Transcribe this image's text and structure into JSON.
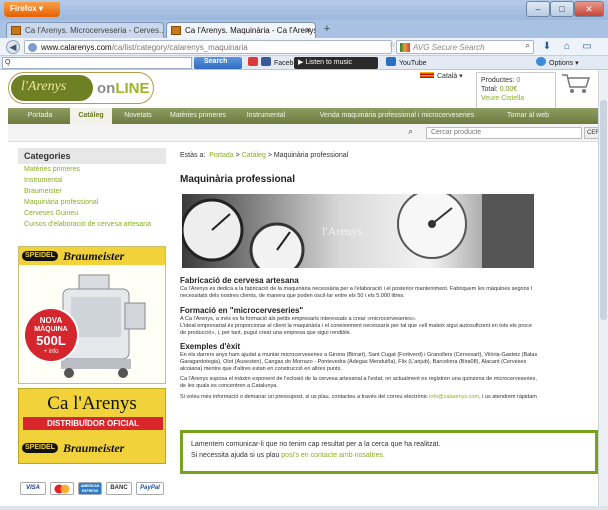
{
  "browser": {
    "firefox_label": "Firefox",
    "tabs": [
      {
        "label": "Ca l'Arenys. Microcerveseria - Cerves..."
      },
      {
        "label": "Ca l'Arenys. Maquinària - Ca l'Arenys"
      }
    ],
    "url_host": "www.calarenys.com",
    "url_path": "/ca/list/category/calarenys_maquinaria",
    "search_placeholder": "AVG Secure Search",
    "toolbar": {
      "query_placeholder": "Q",
      "search_label": "Search",
      "facebook_label": "Facebook",
      "music_label": "Listen to music",
      "youtube_label": "YouTube",
      "options_label": "Options"
    }
  },
  "site": {
    "logo_left": "l'Arenys",
    "logo_on": "on",
    "logo_line": "LINE",
    "language": "Català",
    "cart": {
      "products_label": "Productes:",
      "products_count": "0",
      "total_label": "Total:",
      "total_value": "0.00€",
      "view_label": "Veure Cistella"
    },
    "nav": [
      {
        "label": "Portada",
        "active": false
      },
      {
        "label": "Catàleg",
        "active": true
      },
      {
        "label": "Novetats",
        "active": false
      },
      {
        "label": "Matèries primeres",
        "active": false
      },
      {
        "label": "Instrumental",
        "active": false
      },
      {
        "label": "Venda maquinària professional i microcerveseries",
        "active": false
      },
      {
        "label": "Tornar al web",
        "active": false
      }
    ],
    "search_placeholder": "Cercar producte",
    "search_button": "CER"
  },
  "sidebar": {
    "title": "Categories",
    "items": [
      "Matèries primeres",
      "Instrumental",
      "Braumeister",
      "Maquinària professional",
      "Cerveses Guineu",
      "Cursos d'elaboració de cervesa artesana"
    ],
    "ad1": {
      "tag": "SPEIDEL",
      "brand": "Braumeister",
      "nova": "NOVA",
      "maquina": "MÀQUINA",
      "size": "500L",
      "info": "+ info"
    },
    "ad2": {
      "title": "Ca l'Arenys",
      "distributor": "DISTRIBUÏDOR OFICIAL",
      "tag": "SPEIDEL",
      "brand": "Braumeister"
    },
    "payments": [
      "VISA",
      "",
      "AMERICAN EXPRESS",
      "BANC",
      "PayPal"
    ]
  },
  "main": {
    "breadcrumb": {
      "prefix": "Estàs a:",
      "items": [
        "Portada",
        "Catàleg",
        "Maquinària professional"
      ],
      "sep": ">"
    },
    "title": "Maquinària professional",
    "hero_watermark": "l'Arenys",
    "sections": [
      {
        "title": "Fabricació de cervesa artesana",
        "lines": [
          "Ca l'Arenys es dedica a la fabricació de la maquinària necessària per a l'elaboració i el posterior manteniment. Fabriquem les màquines segons l",
          "necessitats dels nostres clients, de manera que poden oscil·lar entre els 50 i els 5.000 litres."
        ]
      },
      {
        "title": "Formació en \"microcerveseries\"",
        "lines": [
          "A Ca l'Arenys, a més es fa formació als petits empresaris interessats a crear «microcerveseries».",
          "L'ideal empresarial és proporcionar al client la maquinària i el coneixement necessaris per tal que «ell mateix sigui autosuficient en tots els proce",
          "de producció», i, per tant, puguí crear una empresa que sigui rendible."
        ]
      },
      {
        "title": "Exemples d'èxit",
        "lines": [
          "En els darrers anys ham ajudat a muntar microcerveseries a Girona (Birrart), Sant Cugat (Fortiverd) i Granollers (Cervesart), Vilòria-Gasteiz (Balas",
          "Garagardotegia), Olot (Ausesten), Cangas do Morrazo - Pontevedra (Adegas Menduiña), Flix (L'anjub), Barcelona (Bira08), Alacant (Cerveses",
          "alcoiana) mentre que d'altres estan en construcció en altres punts."
        ]
      }
    ],
    "paragraph": "Ca l'Arenys suposa el màxim exponent de l'eclosió de la cervesa artesanal a l'estat, on actualment es registren una quinzena de microcerveseries,",
    "paragraph2": "de les quals es concentren a Catalunya.",
    "contact_prefix": "Si voleu més informació o demanar un pressupost, si us plau, contacteu a través del correu electrònic ",
    "contact_mail": "info@calarenys.com",
    "contact_suffix": ", i us atendrem ràpidam",
    "notice_line1": "Lamentem comunicar-li que no tenim cap resultat per a la cerca que ha realitzat.",
    "notice_line2_prefix": "Si necessita ajuda si us plau ",
    "notice_link": "posi's en contacte amb nosaltres."
  },
  "colors": {
    "accent_green": "#8cae22",
    "nav_olive": "#6d7a3f",
    "speidel_yellow": "#f1d23a",
    "nova_red": "#d4262c"
  }
}
